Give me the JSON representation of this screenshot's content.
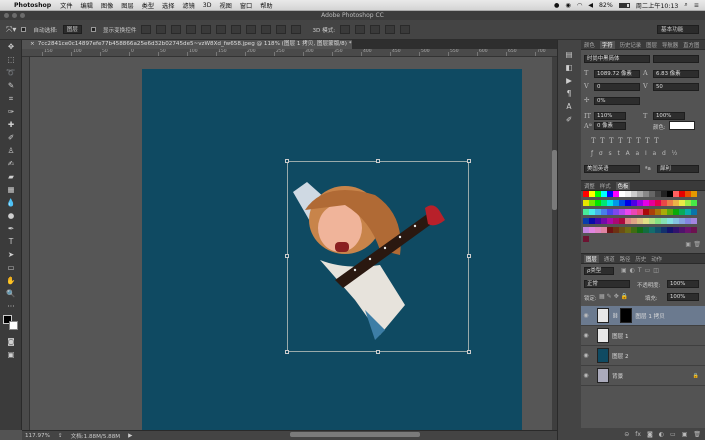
{
  "menubar": {
    "app": "Photoshop",
    "items": [
      "文件",
      "编辑",
      "图像",
      "图层",
      "类型",
      "选择",
      "滤镜",
      "3D",
      "视图",
      "窗口",
      "帮助"
    ],
    "battery": "82%",
    "clock": "周二上午10:13"
  },
  "window": {
    "title": "Adobe Photoshop CC"
  },
  "options": {
    "auto_select": "自动选择:",
    "layer_dropdown": "图层",
    "show_transform": "显示变换控件",
    "mode_3d": "3D 模式:",
    "workspace": "基本功能"
  },
  "document": {
    "tab": "7cc2841ce0c14897efe77b458866a25e6d32b02745de5~vzW8Xd_fw658.jpeg @ 118% (图层 1 拷贝, 图层蒙版/8) *"
  },
  "ruler": [
    "150",
    "100",
    "50",
    "0",
    "50",
    "100",
    "150",
    "200",
    "250",
    "300",
    "350",
    "400",
    "450",
    "500",
    "550",
    "600",
    "650",
    "700"
  ],
  "status": {
    "zoom": "117.97%",
    "doc": "文档:1.88M/5.88M"
  },
  "char_panel": {
    "tabs": [
      "颜色",
      "字符",
      "历史记录",
      "图层",
      "导航器",
      "直方图"
    ],
    "font_family": "时尚中黑简体",
    "font_size": "1089.72 像素",
    "leading": "6.83 像素",
    "kerning": "0",
    "tracking": "50",
    "scale_v": "0%",
    "scale_v2": "110%",
    "scale_h": "100%",
    "baseline": "0 像素",
    "color_label": "颜色:",
    "language": "美国英语",
    "aa": "犀利"
  },
  "swatch_panel": {
    "tabs": [
      "调整",
      "样式",
      "色板"
    ]
  },
  "layers_panel": {
    "tabs": [
      "图层",
      "通道",
      "路径",
      "历史",
      "动作"
    ],
    "filter": "ρ类型",
    "blend": "正常",
    "opacity_label": "不透明度:",
    "opacity": "100%",
    "lock_label": "锁定:",
    "fill_label": "填充:",
    "fill": "100%",
    "layers": [
      {
        "name": "图层 1 拷贝",
        "thumb": "#e8e8e8",
        "selected": true
      },
      {
        "name": "图层 1",
        "thumb": "#e8e8e8",
        "selected": false
      },
      {
        "name": "图层 2",
        "thumb": "#0f4a62",
        "selected": false
      },
      {
        "name": "背景",
        "thumb": "#aab",
        "selected": false
      }
    ]
  },
  "colors": {
    "canvas": "#0f4a62",
    "accent_select": "#6b7a8f"
  }
}
